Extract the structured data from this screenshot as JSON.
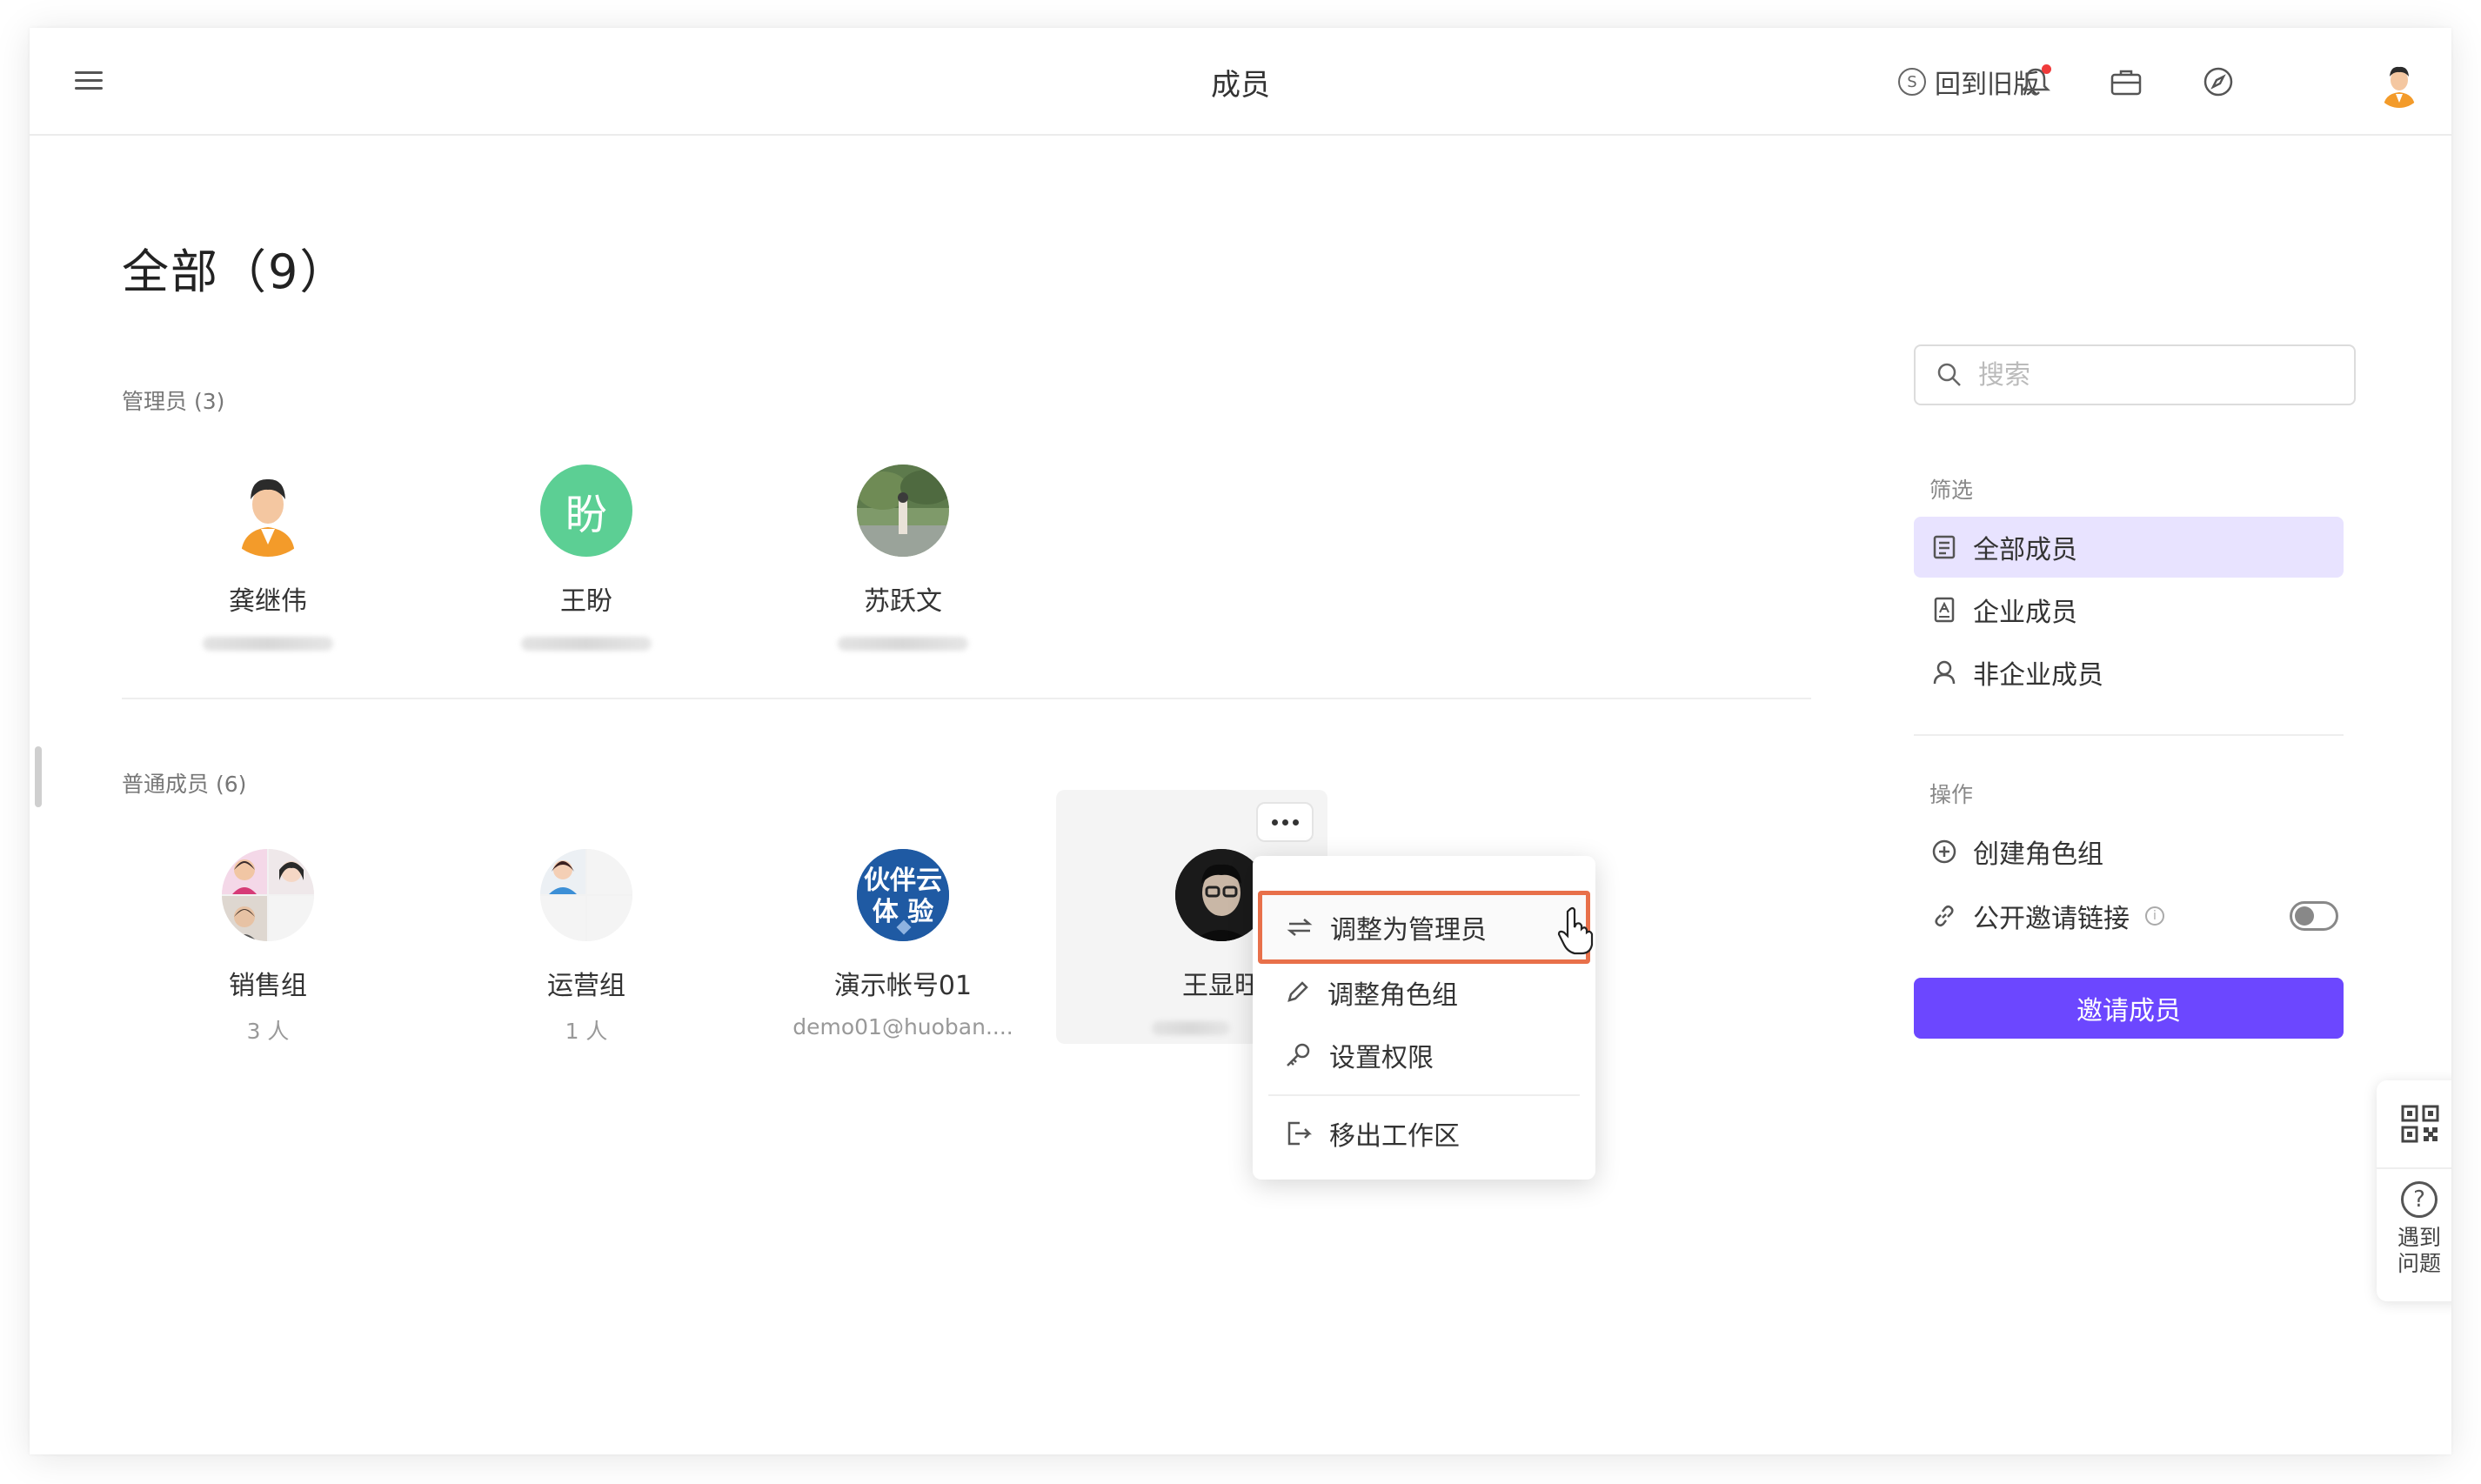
{
  "header": {
    "title": "成员",
    "back_old": "回到旧版"
  },
  "main": {
    "heading": "全部（9）",
    "admins": {
      "label": "管理员 (3)",
      "members": [
        {
          "name": "龚继伟",
          "avatar": "cartoon-man"
        },
        {
          "name": "王盼",
          "avatar_text": "盼",
          "avatar_color": "#5ccf94"
        },
        {
          "name": "苏跃文",
          "avatar": "photo"
        }
      ]
    },
    "regular": {
      "label": "普通成员 (6)",
      "members": [
        {
          "name": "销售组",
          "sub": "3 人"
        },
        {
          "name": "运营组",
          "sub": "1 人"
        },
        {
          "name": "演示帐号01",
          "sub": "demo01@huoban....",
          "avatar_text": "伙伴云体验"
        },
        {
          "name": "王显旺"
        }
      ]
    }
  },
  "context_menu": {
    "items": [
      {
        "label": "调整为管理员",
        "icon": "swap-icon"
      },
      {
        "label": "调整角色组",
        "icon": "pencil-icon"
      },
      {
        "label": "设置权限",
        "icon": "key-icon"
      },
      {
        "label": "移出工作区",
        "icon": "exit-icon"
      }
    ]
  },
  "sidebar": {
    "search_placeholder": "搜索",
    "filter_label": "筛选",
    "filters": [
      {
        "label": "全部成员",
        "active": true
      },
      {
        "label": "企业成员"
      },
      {
        "label": "非企业成员"
      }
    ],
    "actions_label": "操作",
    "actions": [
      {
        "label": "创建角色组"
      },
      {
        "label": "公开邀请链接"
      }
    ],
    "invite_button": "邀请成员"
  },
  "float_panel": {
    "help_label": "遇到问题"
  },
  "colors": {
    "accent": "#6c47ff",
    "active_filter_bg": "#e8e3ff",
    "highlight_border": "#e8704a"
  }
}
